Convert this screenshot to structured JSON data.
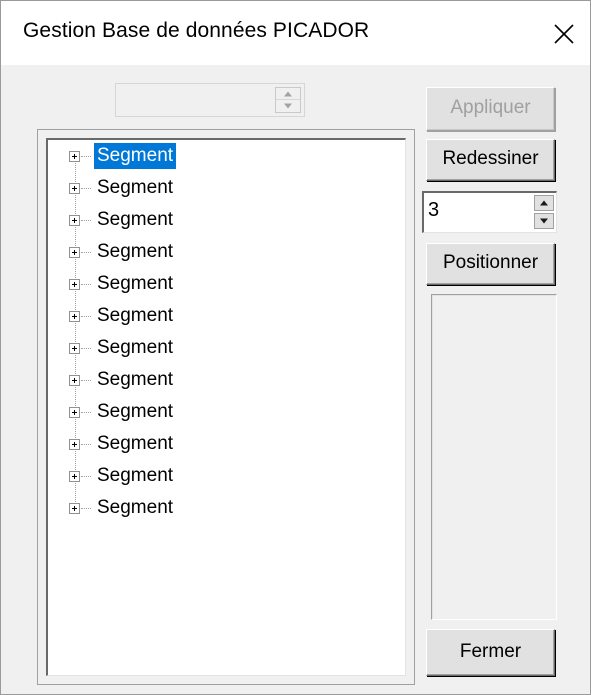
{
  "window": {
    "title": "Gestion Base de données PICADOR"
  },
  "top_spin": {
    "value": ""
  },
  "tree": {
    "items": [
      {
        "label": "Segment",
        "selected": true
      },
      {
        "label": "Segment",
        "selected": false
      },
      {
        "label": "Segment",
        "selected": false
      },
      {
        "label": "Segment",
        "selected": false
      },
      {
        "label": "Segment",
        "selected": false
      },
      {
        "label": "Segment",
        "selected": false
      },
      {
        "label": "Segment",
        "selected": false
      },
      {
        "label": "Segment",
        "selected": false
      },
      {
        "label": "Segment",
        "selected": false
      },
      {
        "label": "Segment",
        "selected": false
      },
      {
        "label": "Segment",
        "selected": false
      },
      {
        "label": "Segment",
        "selected": false
      }
    ]
  },
  "buttons": {
    "apply_label": "Appliquer",
    "apply_enabled": false,
    "redraw_label": "Redessiner",
    "position_label": "Positionner",
    "close_label": "Fermer"
  },
  "position_spin": {
    "value": "3"
  },
  "icons": {
    "close": "close-icon",
    "expand": "plus-box-icon",
    "spin_up": "triangle-up-icon",
    "spin_down": "triangle-down-icon"
  },
  "colors": {
    "selection": "#0078d7",
    "dialog_bg": "#f0f0f0",
    "title_bg": "#ffffff"
  }
}
